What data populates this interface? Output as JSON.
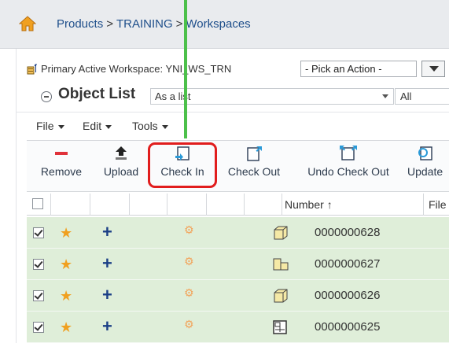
{
  "breadcrumb": {
    "items": [
      "Products",
      "TRAINING",
      "Workspaces"
    ],
    "separator": ">"
  },
  "workspace": {
    "label": "Primary Active Workspace: YNI_WS_TRN",
    "action_select": "- Pick an Action -"
  },
  "object_list": {
    "title": "Object List",
    "view": "As a list",
    "filter": "All"
  },
  "menus": [
    "File",
    "Edit",
    "Tools"
  ],
  "toolbar": {
    "remove": "Remove",
    "upload": "Upload",
    "check_in": "Check In",
    "check_out": "Check Out",
    "undo_check_out": "Undo Check Out",
    "update": "Update"
  },
  "table": {
    "columns": {
      "number": "Number",
      "file": "File"
    },
    "rows": [
      {
        "number": "0000000628",
        "icon": "part-icon"
      },
      {
        "number": "0000000627",
        "icon": "assembly-icon"
      },
      {
        "number": "0000000626",
        "icon": "part-icon"
      },
      {
        "number": "0000000625",
        "icon": "drawing-icon"
      }
    ]
  },
  "colors": {
    "row_selected": "#dfeed9",
    "highlight": "#e11d1d",
    "pointer": "#4cc04a",
    "link": "#1f4f8b"
  }
}
